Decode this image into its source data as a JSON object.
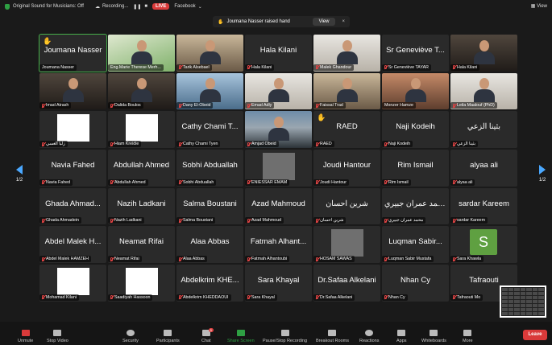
{
  "topbar": {
    "original_sound": "Original Sound for Musicians: Off",
    "recording": "Recording...",
    "live_badge": "LIVE",
    "facebook": "Facebook",
    "view_label": "View"
  },
  "banner": {
    "text": "Joumana Nasser raised hand",
    "view_button": "View",
    "close": "×"
  },
  "pagination": {
    "left": "1/2",
    "right": "1/2"
  },
  "participants": [
    {
      "big": "Joumana Nasser",
      "label": "Joumana Nasser",
      "hand": true,
      "active": true,
      "muted": false
    },
    {
      "big": "",
      "label": "Eng.Marie Therese Merh...",
      "video": "v-green"
    },
    {
      "big": "",
      "label": "Tarik Alsebael",
      "video": "v-room",
      "muted": true
    },
    {
      "big": "Hala Kilani",
      "label": "Hala Kilani",
      "muted": true
    },
    {
      "big": "",
      "label": "Malek Ghandour",
      "video": "v-light",
      "muted": true
    },
    {
      "big": "Sr Geneviève T...",
      "label": "Sr Geneviève TAYAR",
      "muted": true
    },
    {
      "big": "",
      "label": "Hala Kilani",
      "video": "v-dark",
      "muted": true
    },
    {
      "big": "",
      "label": "Imad Atrash",
      "video": "v-dark",
      "muted": true
    },
    {
      "big": "",
      "label": "Dalida Boulos",
      "video": "v-dark",
      "muted": true
    },
    {
      "big": "",
      "label": "Dany El-Obeid",
      "video": "v-blue",
      "muted": true
    },
    {
      "big": "",
      "label": "Emad Adly",
      "video": "v-light",
      "muted": true
    },
    {
      "big": "",
      "label": "Faissal Trad",
      "video": "v-room",
      "muted": true
    },
    {
      "big": "",
      "label": "Monzer Hamze",
      "video": "v-warm"
    },
    {
      "big": "",
      "label": "Leila Maalouf (PhD)",
      "video": "v-light",
      "muted": true
    },
    {
      "big": "",
      "label": "زلبا الغسي",
      "pic": "light",
      "muted": true
    },
    {
      "big": "",
      "label": "Hiam Kreidie",
      "pic": "light",
      "muted": true
    },
    {
      "big": "Cathy Chami T...",
      "label": "Cathy Chami Tyen",
      "muted": true
    },
    {
      "big": "",
      "label": "Amjad Obeid",
      "video": "v-scene",
      "muted": true
    },
    {
      "big": "RAED",
      "label": "RAED",
      "hand": true,
      "muted": true
    },
    {
      "big": "Naji Kodeih",
      "label": "Naji Kodeih",
      "muted": true
    },
    {
      "big": "بثينا الزعي",
      "label": "بثينا الزعي",
      "muted": true
    },
    {
      "big": "Navia Fahed",
      "label": "Navia Fahed",
      "muted": true
    },
    {
      "big": "Abdullah Ahmed",
      "label": "Abdullah Ahmed",
      "muted": true
    },
    {
      "big": "Sobhi Abduallah",
      "label": "Sobhi Abduallah",
      "muted": true
    },
    {
      "big": "",
      "label": "ENIESSAR EMAM",
      "pic": "dark",
      "muted": true
    },
    {
      "big": "Joudi Hantour",
      "label": "Joudi Hantour",
      "muted": true
    },
    {
      "big": "Rim Ismail",
      "label": "Rim Ismail",
      "muted": true
    },
    {
      "big": "alyaa ali",
      "label": "alyaa ali",
      "muted": true
    },
    {
      "big": "Ghada Ahmad...",
      "label": "Ghada Ahmadein",
      "muted": true
    },
    {
      "big": "Nazih Ladkani",
      "label": "Nazih Ladkani",
      "muted": true
    },
    {
      "big": "Salma Boustani",
      "label": "Salma Boustani",
      "muted": true
    },
    {
      "big": "Azad Mahmoud",
      "label": "Azad Mahmoud",
      "muted": true
    },
    {
      "big": "شرين احسان",
      "label": "شرين احسان",
      "muted": true
    },
    {
      "big": "محمد عمران جبيري",
      "label": "محمد عمران جبيري",
      "muted": true
    },
    {
      "big": "sardar Kareem",
      "label": "sardar Kareem",
      "muted": true
    },
    {
      "big": "Abdel Malek H...",
      "label": "Abdel Malek HAMZEH",
      "muted": true
    },
    {
      "big": "Neamat Rifai",
      "label": "Neamat Rifai",
      "muted": true
    },
    {
      "big": "Alaa Abbas",
      "label": "Alaa Abbas",
      "muted": true
    },
    {
      "big": "Fatmah Alhant...",
      "label": "Fatmah Alhantoubi",
      "muted": true
    },
    {
      "big": "",
      "label": "HOSAM SAWAS",
      "pic": "dark",
      "muted": true
    },
    {
      "big": "Luqman Sabir...",
      "label": "Luqman Sabir Mustafa",
      "muted": true
    },
    {
      "big": "",
      "label": "Sara Khawla",
      "avatar": "S",
      "muted": true
    },
    {
      "big": "",
      "label": "Mohamad Kilani",
      "pic": "light",
      "muted": true
    },
    {
      "big": "",
      "label": "Saadiyah Hassoon",
      "pic": "light",
      "muted": true
    },
    {
      "big": "Abdelkrim KHE...",
      "label": "Abdelkrim KHEDDAOUI",
      "muted": true
    },
    {
      "big": "Sara Khayal",
      "label": "Sara Khayal",
      "muted": true
    },
    {
      "big": "Dr.Safaa Alkelani",
      "label": "Dr.Safaa Alkelani",
      "muted": true
    },
    {
      "big": "Nhan Cy",
      "label": "Nhan Cy",
      "muted": true
    },
    {
      "big": "Tafraouti",
      "label": "Tafraouti Mo",
      "muted": true
    }
  ],
  "toolbar": {
    "unmute": "Unmute",
    "stop_video": "Stop Video",
    "security": "Security",
    "participants": "Participants",
    "participants_count": "99",
    "chat": "Chat",
    "chat_badge": "5",
    "share_screen": "Share Screen",
    "pause_recording": "Pause/Stop Recording",
    "breakout_rooms": "Breakout Rooms",
    "reactions": "Reactions",
    "apps": "Apps",
    "whiteboards": "Whiteboards",
    "more": "More",
    "leave": "Leave"
  },
  "colors": {
    "accent_green": "#2ea043",
    "leave_red": "#d93a3a",
    "nav_blue": "#4aa8ff"
  }
}
